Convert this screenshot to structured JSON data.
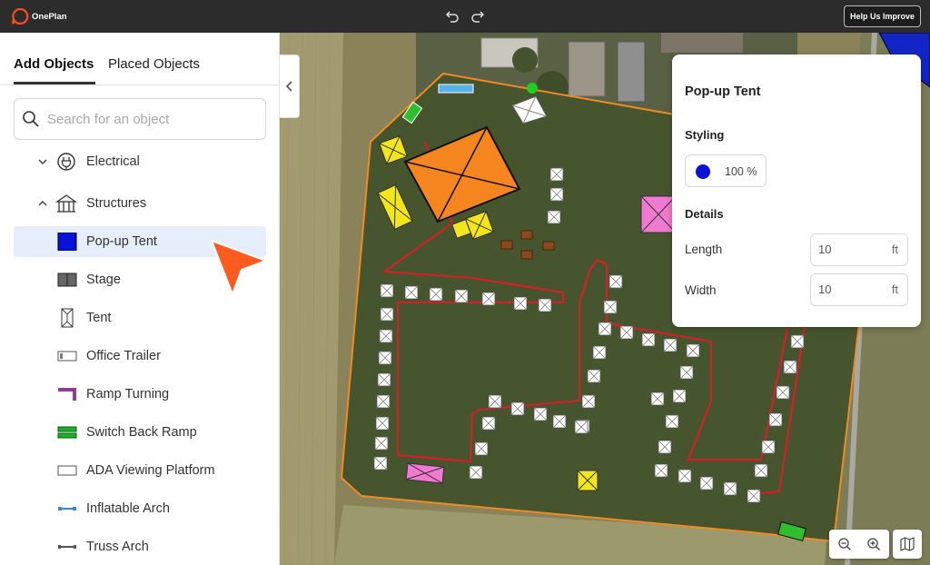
{
  "app": {
    "name": "OnePlan"
  },
  "topbar": {
    "help_label": "Help Us Improve"
  },
  "sidebar": {
    "tabs": [
      {
        "label": "Add Objects"
      },
      {
        "label": "Placed Objects"
      }
    ],
    "search_placeholder": "Search for an object",
    "categories": [
      {
        "label": "Electrical"
      },
      {
        "label": "Structures"
      }
    ],
    "objects": [
      {
        "label": "Pop-up Tent",
        "icon": "blue-square-icon"
      },
      {
        "label": "Stage",
        "icon": "stage-icon"
      },
      {
        "label": "Tent",
        "icon": "tent-icon"
      },
      {
        "label": "Office Trailer",
        "icon": "office-trailer-icon"
      },
      {
        "label": "Ramp Turning",
        "icon": "ramp-turning-icon"
      },
      {
        "label": "Switch Back Ramp",
        "icon": "switch-back-ramp-icon"
      },
      {
        "label": "ADA Viewing Platform",
        "icon": "ada-platform-icon"
      },
      {
        "label": "Inflatable Arch",
        "icon": "inflatable-arch-icon"
      },
      {
        "label": "Truss Arch",
        "icon": "truss-arch-icon"
      }
    ]
  },
  "properties": {
    "title": "Pop-up Tent",
    "styling_heading": "Styling",
    "color": "#0a12d8",
    "opacity_label": "100 %",
    "details_heading": "Details",
    "length": {
      "label": "Length",
      "value": "10",
      "unit": "ft"
    },
    "width": {
      "label": "Width",
      "value": "10",
      "unit": "ft"
    }
  },
  "colors": {
    "accent": "#ff5a1f",
    "selected_row": "#e6eefb",
    "boundary": "#f08a24",
    "route": "#d0202a"
  }
}
